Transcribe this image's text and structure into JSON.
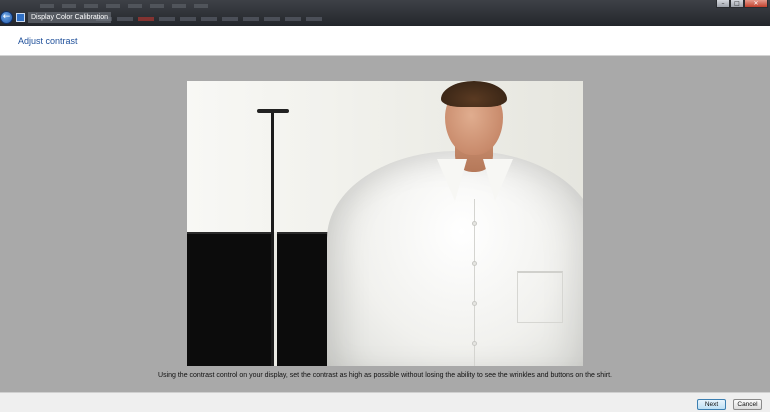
{
  "window": {
    "title": "Display Color Calibration",
    "controls": {
      "minimize": "–",
      "maximize": "□",
      "close": "✕"
    },
    "back_icon": "back-arrow-icon"
  },
  "header": {
    "title": "Adjust contrast"
  },
  "main": {
    "instruction": "Using the contrast control on your display, set the contrast as high as possible without losing the ability to see the wrinkles and buttons on the shirt."
  },
  "footer": {
    "next_label": "Next",
    "cancel_label": "Cancel"
  },
  "colors": {
    "accent": "#1e4f9a",
    "background": "#a9a9a9"
  }
}
